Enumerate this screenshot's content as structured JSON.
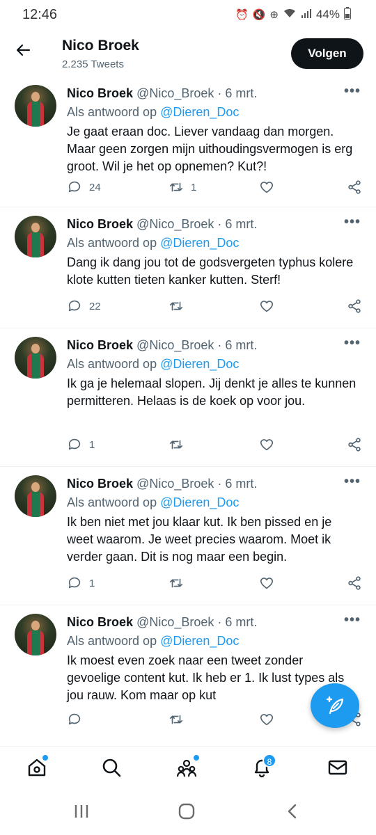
{
  "status_bar": {
    "time": "12:46",
    "battery": "44%",
    "icons": [
      "alarm-icon",
      "mute-icon",
      "data-saver-icon",
      "wifi-icon",
      "signal-icon",
      "battery-icon"
    ]
  },
  "header": {
    "name": "Nico Broek",
    "subtitle": "2.235 Tweets",
    "follow_label": "Volgen"
  },
  "tweets": [
    {
      "name": "Nico Broek",
      "meta": "@Nico_Broek · 6 mrt.",
      "reply_prefix": "Als antwoord op",
      "reply_to": "@Dieren_Doc",
      "text": "Je gaat eraan doc. Liever vandaag dan morgen. Maar geen zorgen mijn uithoudingsvermogen is erg groot. Wil je het op opnemen?  Kut?!",
      "replies": "24",
      "retweets": "1"
    },
    {
      "name": "Nico Broek",
      "meta": "@Nico_Broek · 6 mrt.",
      "reply_prefix": "Als antwoord op",
      "reply_to": "@Dieren_Doc",
      "text": "Dang ik dang jou tot de godsvergeten typhus kolere klote kutten tieten kanker kutten. Sterf!",
      "replies": "22",
      "retweets": ""
    },
    {
      "name": "Nico Broek",
      "meta": "@Nico_Broek · 6 mrt.",
      "reply_prefix": "Als antwoord op",
      "reply_to": "@Dieren_Doc",
      "text": "Ik ga je helemaal slopen. Jij denkt je alles te kunnen permitteren. Helaas is de koek op voor jou.",
      "replies": "1",
      "retweets": ""
    },
    {
      "name": "Nico Broek",
      "meta": "@Nico_Broek · 6 mrt.",
      "reply_prefix": "Als antwoord op",
      "reply_to": "@Dieren_Doc",
      "text": "Ik ben niet met jou klaar kut. Ik ben pissed en je weet waarom. Je weet precies waarom. Moet ik verder gaan. Dit is nog maar een begin.",
      "replies": "1",
      "retweets": ""
    },
    {
      "name": "Nico Broek",
      "meta": "@Nico_Broek · 6 mrt.",
      "reply_prefix": "Als antwoord op",
      "reply_to": "@Dieren_Doc",
      "text": "Ik moest even zoek naar een tweet zonder gevoelige content kut. Ik heb er 1. Ik lust types als jou rauw. Kom maar op kut",
      "replies": "",
      "retweets": ""
    }
  ],
  "bottom_nav": {
    "notifications_badge": "8",
    "items": [
      "home-icon",
      "search-icon",
      "communities-icon",
      "notifications-icon",
      "messages-icon"
    ]
  },
  "colors": {
    "accent": "#1d9bf0",
    "text": "#0f1419",
    "secondary": "#536471"
  }
}
